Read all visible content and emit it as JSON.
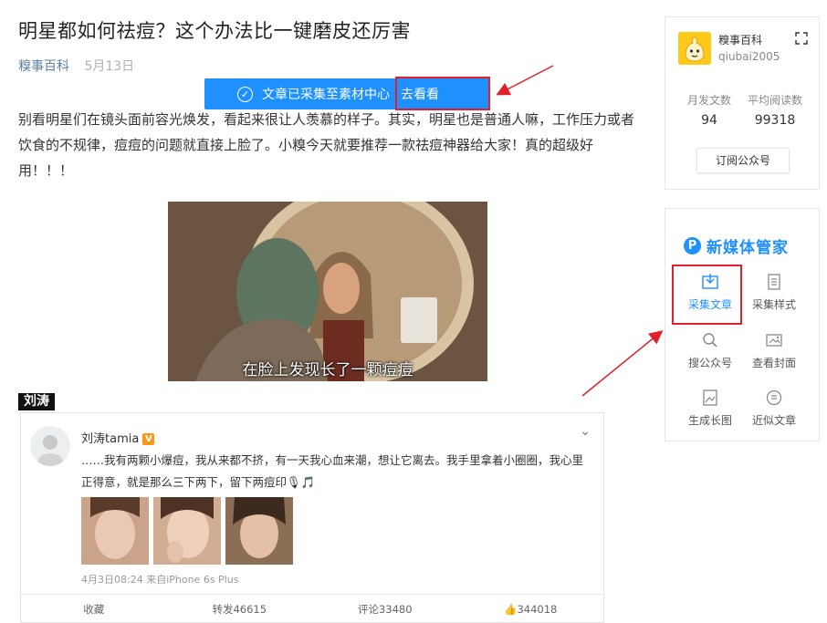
{
  "article": {
    "title": "明星都如何祛痘？这个办法比一键磨皮还厉害",
    "account": "糗事百科",
    "date": "5月13日",
    "paragraph": "别看明星们在镜头面前容光焕发，看起来很让人羡慕的样子。其实，明星也是普通人嘛，工作压力或者饮食的不规律，痘痘的问题就直接上脸了。小糗今天就要推荐一款祛痘神器给大家！真的超级好用！！！",
    "image_caption": "在脸上发现长了一颗痘痘",
    "name_tag": "刘涛"
  },
  "toast": {
    "message": "文章已采集至素材中心",
    "link": "去看看"
  },
  "weibo": {
    "username": "刘涛tamia",
    "verified_badge": "V",
    "text": "……我有两颗小爆痘，我从来都不挤，有一天我心血来潮，想让它离去。我手里拿着小圈圈，我心里正得意，就是那么三下两下，留下两痘印🎙🎵",
    "timestamp": "4月3日08:24 来自iPhone 6s Plus",
    "actions": {
      "favorite": "收藏",
      "repost": "转发46615",
      "comment": "评论33480",
      "like": "344018"
    }
  },
  "sidebar": {
    "account_name": "糗事百科",
    "account_id": "qiubai2005",
    "stats": [
      {
        "label": "月发文数",
        "value": "94"
      },
      {
        "label": "平均阅读数",
        "value": "99318"
      }
    ],
    "subscribe": "订阅公众号"
  },
  "tools": {
    "brand": "新媒体管家",
    "brand_icon": "P",
    "items": [
      {
        "label": "采集文章",
        "icon": "collect-article-icon"
      },
      {
        "label": "采集样式",
        "icon": "collect-style-icon"
      },
      {
        "label": "搜公众号",
        "icon": "search-icon"
      },
      {
        "label": "查看封面",
        "icon": "cover-image-icon"
      },
      {
        "label": "生成长图",
        "icon": "long-image-icon"
      },
      {
        "label": "近似文章",
        "icon": "similar-article-icon"
      }
    ]
  },
  "colors": {
    "accent": "#1e90ff",
    "highlight_box": "#e0202a",
    "account_link": "#607fa6"
  }
}
